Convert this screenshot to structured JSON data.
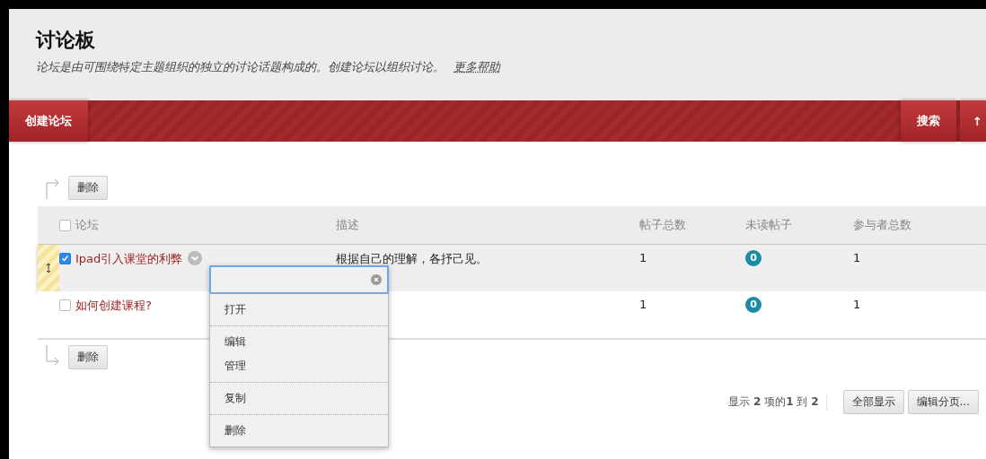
{
  "header": {
    "title": "讨论板",
    "description": "论坛是由可围绕特定主题组织的独立的讨论话题构成的。创建论坛以组织讨论。",
    "help_link": "更多帮助"
  },
  "action_bar": {
    "create": "创建论坛",
    "search": "搜索",
    "sort": "↑"
  },
  "top_delete": "删除",
  "table": {
    "select_all_checked": false,
    "columns": [
      "论坛",
      "描述",
      "帖子总数",
      "未读帖子",
      "参与者总数"
    ],
    "rows": [
      {
        "name": "Ipad引入课堂的利弊",
        "description": "根据自己的理解，各抒己见。",
        "posts": "1",
        "unread": "0",
        "participants": "1",
        "checked": true,
        "selected": true
      },
      {
        "name": "如何创建课程?",
        "description": "",
        "posts": "1",
        "unread": "0",
        "participants": "1",
        "checked": false,
        "selected": false
      }
    ]
  },
  "bottom_delete": "删除",
  "context_menu": {
    "groups": [
      [
        "打开"
      ],
      [
        "编辑",
        "管理"
      ],
      [
        "复制"
      ],
      [
        "删除"
      ]
    ]
  },
  "pagination": {
    "summary": "显示 **2** 项的**1** 到 **2**",
    "show_all": "全部显示",
    "edit_paging": "编辑分页..."
  }
}
